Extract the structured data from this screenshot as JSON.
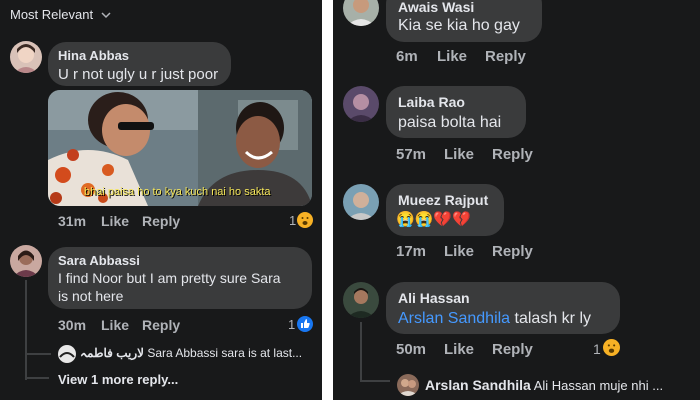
{
  "left": {
    "sort_label": "Most Relevant",
    "comments": [
      {
        "name": "Hina Abbas",
        "text": "U r not ugly u r just poor",
        "meme_caption": "bhai paisa ho to kya kuch nai ho sakta",
        "time": "31m",
        "like": "Like",
        "reply": "Reply",
        "reactions": "1"
      },
      {
        "name": "Sara Abbassi",
        "text_line1": "I find Noor but I am pretty sure Sara",
        "text_line2": "is not here",
        "time": "30m",
        "like": "Like",
        "reply": "Reply",
        "reactions": "1"
      }
    ],
    "reply_preview": {
      "name": "لاریب فاطمہ",
      "text": "Sara Abbassi sara is at last..."
    },
    "view_more": "View 1 more reply..."
  },
  "right": {
    "comments": [
      {
        "name": "Awais Wasi",
        "text": "Kia se kia ho gay",
        "time": "6m",
        "like": "Like",
        "reply": "Reply"
      },
      {
        "name": "Laiba Rao",
        "text": "paisa bolta hai",
        "time": "57m",
        "like": "Like",
        "reply": "Reply"
      },
      {
        "name": "Mueez Rajput",
        "text": "😭😭💔💔",
        "time": "17m",
        "like": "Like",
        "reply": "Reply"
      },
      {
        "name": "Ali Hassan",
        "mention": "Arslan Sandhila",
        "text": " talash kr ly",
        "time": "50m",
        "like": "Like",
        "reply": "Reply",
        "reactions": "1"
      }
    ],
    "reply_preview": {
      "name": "Arslan Sandhila",
      "text": "Ali Hassan muje nhi ..."
    }
  },
  "colors": {
    "background": "#18191a",
    "bubble": "#3a3b3c",
    "text": "#e4e6eb",
    "secondary": "#b0b3b8",
    "link": "#4599ff",
    "like_reaction": "#1877f2",
    "haha_reaction": "#f7b125"
  },
  "icons": [
    "chevron-down-icon",
    "haha-reaction-icon",
    "like-reaction-icon"
  ]
}
